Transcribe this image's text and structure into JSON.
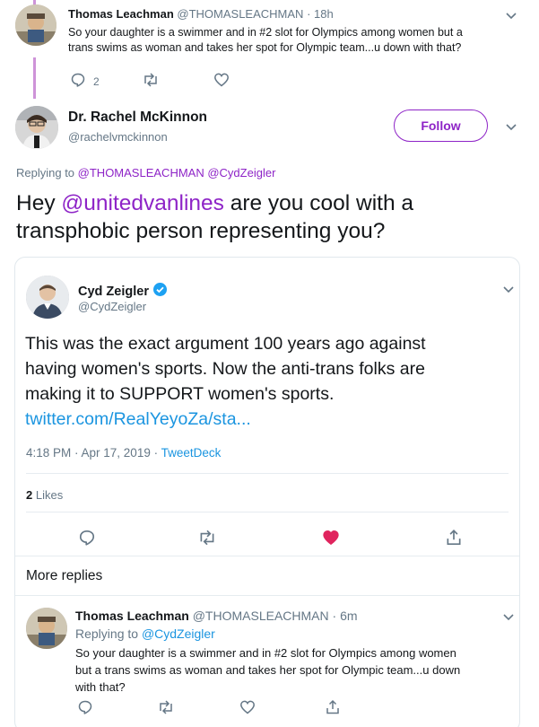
{
  "top_reply": {
    "name": "Thomas Leachman",
    "handle": "@THOMASLEACHMAN",
    "dot": "·",
    "time": "18h",
    "text_line1": "So your daughter is a swimmer and in #2 slot for Olympics among women but a",
    "text_line2": "trans swims as woman and takes her spot for Olympic team...u down with that?",
    "reply_count": "2"
  },
  "main_tweet": {
    "name": "Dr. Rachel McKinnon",
    "handle": "@rachelvmckinnon",
    "follow_label": "Follow",
    "replying_prefix": "Replying to",
    "replying_user1": "@THOMASLEACHMAN",
    "replying_user2": "@CydZeigler",
    "body_pre": "Hey",
    "body_mention": "@unitedvanlines",
    "body_post": "are you cool with a",
    "body_line2": "transphobic person representing you?"
  },
  "quoted_tweet": {
    "name": "Cyd Zeigler",
    "handle": "@CydZeigler",
    "line1": "This was the exact argument 100 years ago against",
    "line2": "having women's sports. Now the anti-trans folks are",
    "line3": "making it to SUPPORT women's sports.",
    "link": "twitter.com/RealYeyoZa/sta...",
    "timestamp": "4:18 PM · Apr 17, 2019 ·",
    "source": "TweetDeck",
    "likes_count": "2",
    "likes_label": "Likes",
    "more_replies": "More replies"
  },
  "reply": {
    "name": "Thomas Leachman",
    "handle": "@THOMASLEACHMAN",
    "dot": "·",
    "time": "6m",
    "replying_prefix": "Replying to",
    "replying_user": "@CydZeigler",
    "line1": "So your daughter is a swimmer and in #2 slot for Olympics among women",
    "line2": "but a trans swims as woman and takes her spot for Olympic team...u down",
    "line3": "with that?"
  },
  "colors": {
    "accent": "#8e24c7",
    "link_blue": "#1b95e0",
    "heart": "#e0245e",
    "gray": "#657786",
    "verified": "#1da1f2"
  },
  "icons": [
    "reply-icon",
    "retweet-icon",
    "like-icon",
    "share-icon",
    "chevron-down-icon",
    "verified-badge-icon"
  ]
}
